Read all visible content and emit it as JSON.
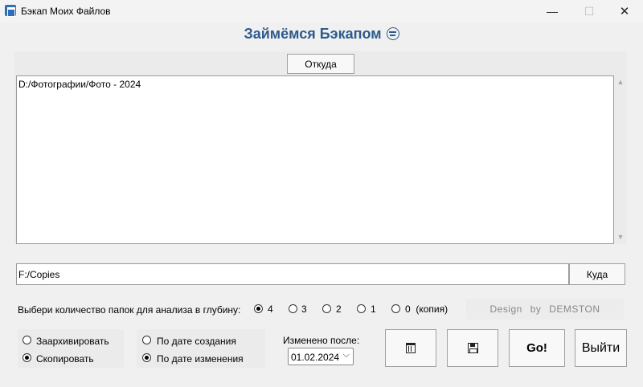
{
  "window": {
    "title": "Бэкап Моих Файлов"
  },
  "header": {
    "title": "Займёмся Бэкапом"
  },
  "source": {
    "button_label": "Откуда",
    "items": [
      "D:/Фотографии/Фото - 2024"
    ]
  },
  "destination": {
    "path": "F:/Copies",
    "button_label": "Куда"
  },
  "depth": {
    "label": "Выбери количество папок для анализа в глубину:",
    "options": [
      "4",
      "3",
      "2",
      "1",
      "0  (копия)"
    ],
    "selected": "4"
  },
  "credit": "Design  by  DEMSTON",
  "action_mode": {
    "options": [
      "Заархивировать",
      "Скопировать"
    ],
    "selected": "Скопировать"
  },
  "date_mode": {
    "options": [
      "По дате создания",
      "По дате изменения"
    ],
    "selected": "По дате изменения"
  },
  "modified_after": {
    "label": "Изменено после:",
    "value": "01.02.2024"
  },
  "buttons": {
    "clear_icon": "trash-icon",
    "save_icon": "floppy-disk-icon",
    "go_label": "Go!",
    "exit_label": "Выйти"
  }
}
